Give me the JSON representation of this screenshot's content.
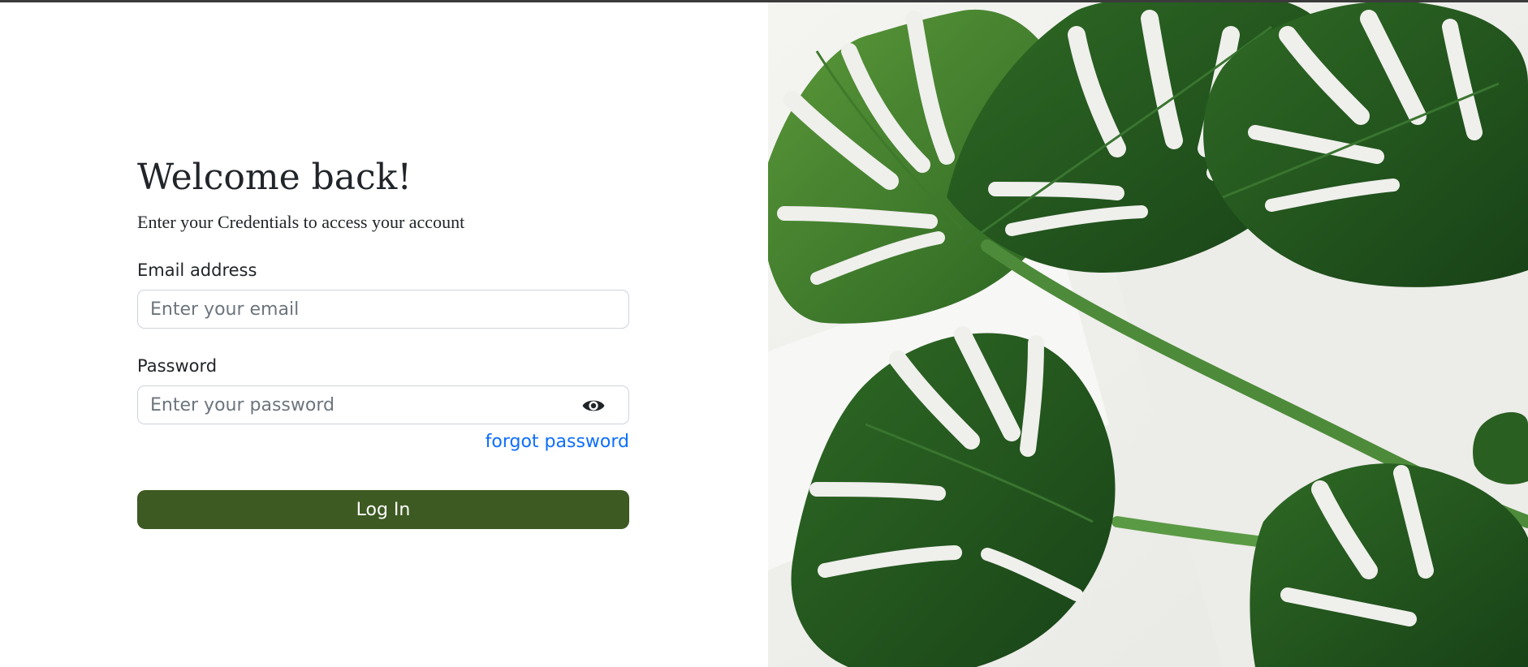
{
  "login": {
    "title": "Welcome back!",
    "subtitle": "Enter your Credentials to access your account",
    "email_label": "Email address",
    "email_placeholder": "Enter your email",
    "email_value": "",
    "password_label": "Password",
    "password_placeholder": "Enter your password",
    "password_value": "",
    "forgot_password": "forgot password",
    "login_button": "Log In"
  },
  "icons": {
    "password_toggle": "eye-icon"
  },
  "hero_image": {
    "subject": "monstera leaves"
  },
  "colors": {
    "primary_button": "#3d5a22",
    "link": "#0d6efd",
    "text": "#212529",
    "input_border": "#ced4da",
    "leaf_dark": "#1f4f1c",
    "leaf_mid": "#2e6b24",
    "leaf_light": "#4a8a32",
    "background_wall": "#efefec"
  }
}
